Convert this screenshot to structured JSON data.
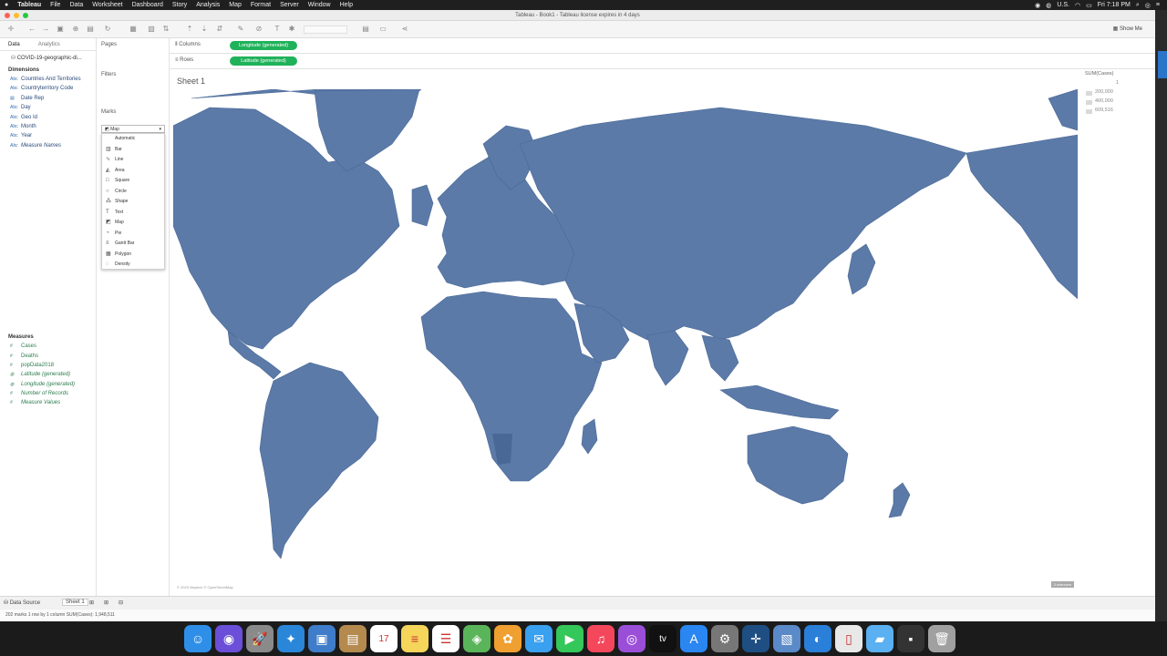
{
  "menubar": {
    "apple": "",
    "items": [
      "Tableau",
      "File",
      "Data",
      "Worksheet",
      "Dashboard",
      "Story",
      "Analysis",
      "Map",
      "Format",
      "Server",
      "Window",
      "Help"
    ],
    "right": {
      "input": "U.S.",
      "clock": "Fri 7:18 PM"
    }
  },
  "window": {
    "title": "Tableau - Book1 - Tableau license expires in 4 days"
  },
  "toolbar": {
    "show_me": "Show Me"
  },
  "left_panel": {
    "tabs": {
      "data": "Data",
      "analytics": "Analytics"
    },
    "datasource": "COVID-19-geographic-di...",
    "dimensions_title": "Dimensions",
    "dimensions": [
      {
        "label": "Countries And Territories",
        "icon": "Abc"
      },
      {
        "label": "Countryterritory Code",
        "icon": "Abc"
      },
      {
        "label": "Date Rep",
        "icon": "date"
      },
      {
        "label": "Day",
        "icon": "Abc"
      },
      {
        "label": "Geo Id",
        "icon": "Abc"
      },
      {
        "label": "Month",
        "icon": "Abc"
      },
      {
        "label": "Year",
        "icon": "Abc"
      },
      {
        "label": "Measure Names",
        "icon": "Abc"
      }
    ],
    "measures_title": "Measures",
    "measures": [
      {
        "label": "Cases",
        "icon": "#"
      },
      {
        "label": "Deaths",
        "icon": "#"
      },
      {
        "label": "popData2018",
        "icon": "#"
      },
      {
        "label": "Latitude (generated)",
        "icon": "globe"
      },
      {
        "label": "Longitude (generated)",
        "icon": "globe"
      },
      {
        "label": "Number of Records",
        "icon": "#"
      },
      {
        "label": "Measure Values",
        "icon": "#"
      }
    ]
  },
  "shelves": {
    "pages": "Pages",
    "filters": "Filters",
    "marks": "Marks",
    "mark_type_selected": "Map",
    "mark_types": [
      "Automatic",
      "Bar",
      "Line",
      "Area",
      "Square",
      "Circle",
      "Shape",
      "Text",
      "Map",
      "Pie",
      "Gantt Bar",
      "Polygon",
      "Density"
    ],
    "columns_label": "Columns",
    "columns_pill": "Longitude (generated)",
    "rows_label": "Rows",
    "rows_pill": "Latitude (generated)"
  },
  "sheet": {
    "title": "Sheet 1",
    "credit": "© 2020 Mapbox © OpenStreetMap",
    "unknown_badge": "3 unknown",
    "map_fill": "#5b7aa8",
    "map_highlight": "#4a6896"
  },
  "legend": {
    "title": "SUM(Cases)",
    "entries": [
      "1",
      "200,000",
      "400,000",
      "609,516"
    ]
  },
  "bottom_tabs": {
    "datasource": "Data Source",
    "sheet1": "Sheet 1"
  },
  "status": {
    "text": "202 marks   1 row by 1 column   SUM(Cases): 1,948,511"
  },
  "dock": {
    "apps": [
      {
        "name": "finder-icon",
        "color": "#2f8fe8",
        "glyph": "☺"
      },
      {
        "name": "siri-icon",
        "color": "#6b4fd8",
        "glyph": "◉"
      },
      {
        "name": "launchpad-icon",
        "color": "#8a8a8a",
        "glyph": "🚀"
      },
      {
        "name": "safari-icon",
        "color": "#2a86d8",
        "glyph": "✦"
      },
      {
        "name": "preview-icon",
        "color": "#3f7cc9",
        "glyph": "▣"
      },
      {
        "name": "contacts-icon",
        "color": "#b58a4e",
        "glyph": "▤"
      },
      {
        "name": "calendar-icon",
        "color": "#ffffff",
        "glyph": "17"
      },
      {
        "name": "notes-icon",
        "color": "#f5d55a",
        "glyph": "≡"
      },
      {
        "name": "reminders-icon",
        "color": "#ffffff",
        "glyph": "☰"
      },
      {
        "name": "maps-icon",
        "color": "#5ab55a",
        "glyph": "◈"
      },
      {
        "name": "photos-icon",
        "color": "#f0a030",
        "glyph": "✿"
      },
      {
        "name": "messages-icon",
        "color": "#3aa0f0",
        "glyph": "✉"
      },
      {
        "name": "facetime-icon",
        "color": "#34c759",
        "glyph": "▶"
      },
      {
        "name": "music-icon",
        "color": "#f4475c",
        "glyph": "♫"
      },
      {
        "name": "podcasts-icon",
        "color": "#9b4fd8",
        "glyph": "◎"
      },
      {
        "name": "tv-icon",
        "color": "#111111",
        "glyph": "tv"
      },
      {
        "name": "appstore-icon",
        "color": "#2a86f0",
        "glyph": "A"
      },
      {
        "name": "system-preferences-icon",
        "color": "#777777",
        "glyph": "⚙"
      },
      {
        "name": "tableau-icon",
        "color": "#1f4f82",
        "glyph": "✛"
      },
      {
        "name": "image-capture-icon",
        "color": "#5a8ac8",
        "glyph": "▧"
      },
      {
        "name": "browser-icon",
        "color": "#2a7fd8",
        "glyph": "◐"
      },
      {
        "name": "document-icon",
        "color": "#e8e8e8",
        "glyph": "▯"
      },
      {
        "name": "folder-icon",
        "color": "#5ab0f0",
        "glyph": "▰"
      },
      {
        "name": "screenshot-icon",
        "color": "#333333",
        "glyph": "▪"
      },
      {
        "name": "trash-icon",
        "color": "#a0a0a0",
        "glyph": "🗑"
      }
    ]
  }
}
